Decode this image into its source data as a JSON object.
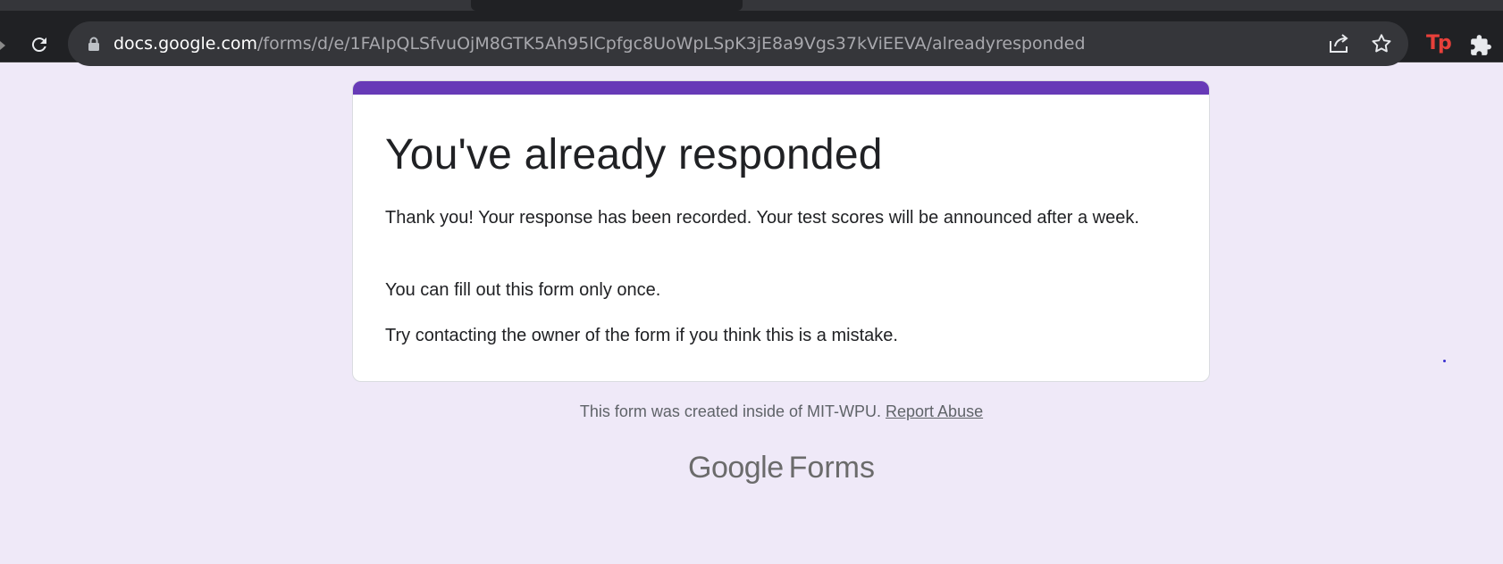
{
  "browser": {
    "url_host": "docs.google.com",
    "url_path": "/forms/d/e/1FAIpQLSfvuOjM8GTK5Ah95lCpfgc8UoWpLSpK3jE8a9Vgs37kViEEVA/alreadyresponded",
    "extension_label": "Tp",
    "extension_color": "#e8403a",
    "icons": [
      "reload-icon",
      "lock-icon",
      "share-icon",
      "star-icon",
      "puzzle-icon"
    ]
  },
  "card": {
    "accent_color": "#673ab7",
    "title": "You've already responded",
    "message_1": "Thank you! Your response has been recorded. Your test scores will be announced after a week.",
    "message_2": "You can fill out this form only once.",
    "message_3": "Try contacting the owner of the form if you think this is a mistake."
  },
  "footer": {
    "note": "This form was created inside of MIT-WPU.",
    "report_link": "Report Abuse",
    "brand_google": "Google",
    "brand_forms": "Forms"
  },
  "page": {
    "background_color": "#efe9f8"
  }
}
